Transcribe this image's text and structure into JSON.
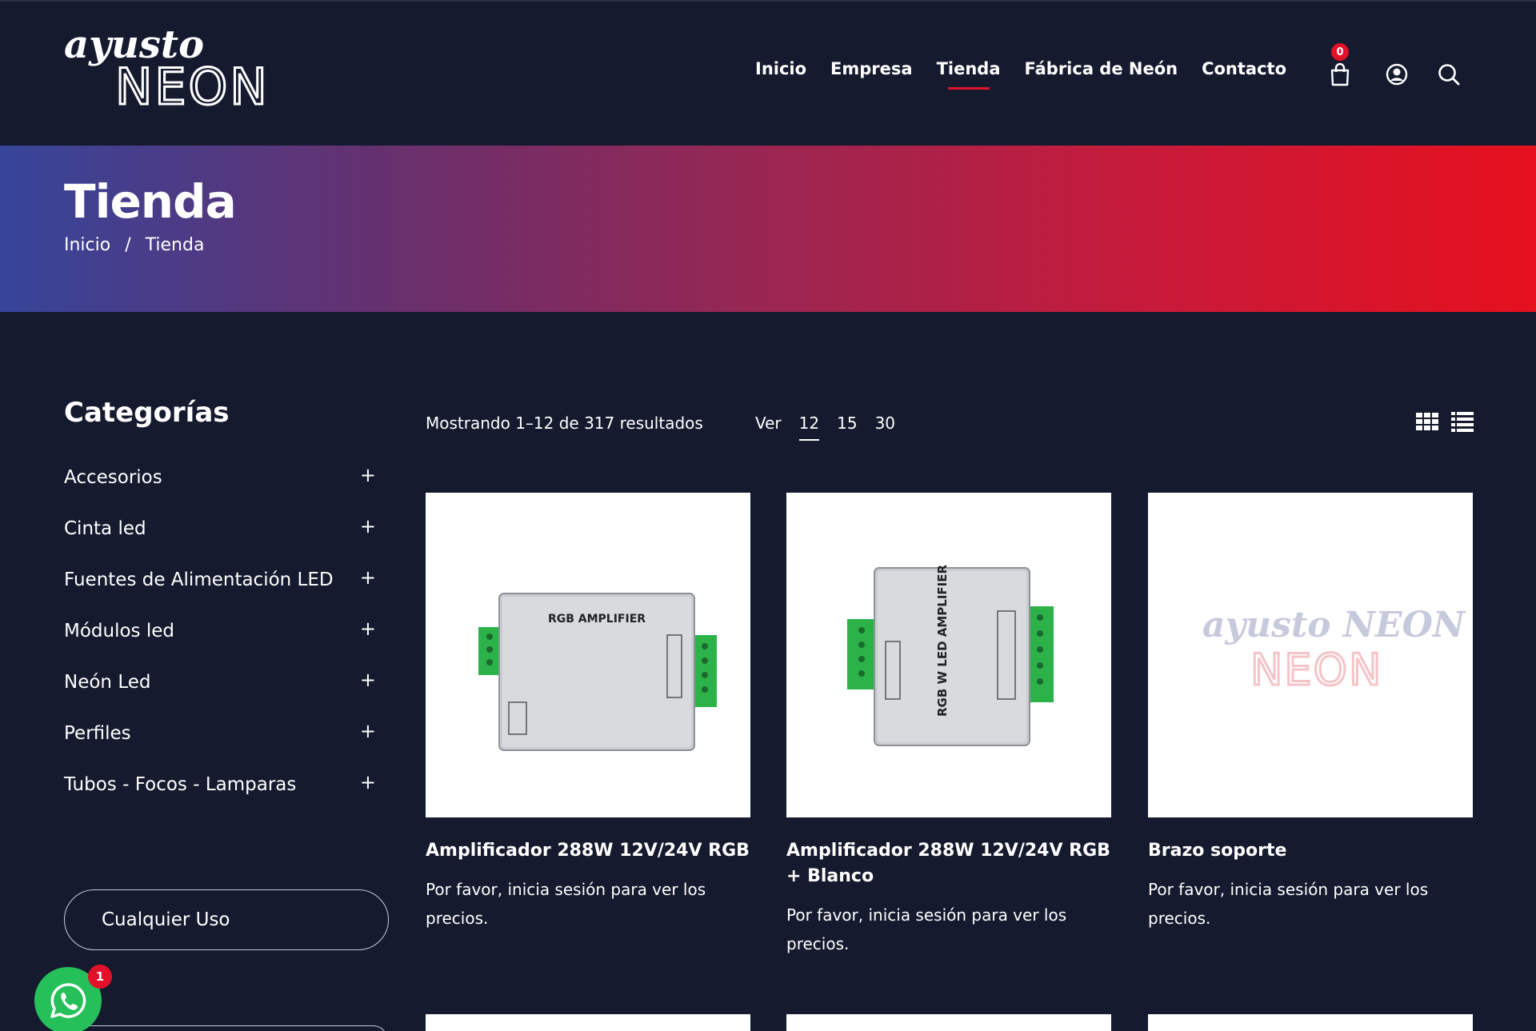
{
  "header": {
    "logo": {
      "line1": "ayusto",
      "line2": "NEON"
    },
    "nav": [
      {
        "label": "Inicio",
        "active": false
      },
      {
        "label": "Empresa",
        "active": false
      },
      {
        "label": "Tienda",
        "active": true
      },
      {
        "label": "Fábrica de Neón",
        "active": false
      },
      {
        "label": "Contacto",
        "active": false
      }
    ],
    "cart_count": "0",
    "icons": [
      "shopping-bag-icon",
      "user-icon",
      "search-icon"
    ]
  },
  "banner": {
    "title": "Tienda",
    "breadcrumb": [
      "Inicio",
      "/",
      "Tienda"
    ]
  },
  "sidebar": {
    "title": "Categorías",
    "categories": [
      {
        "label": "Accesorios",
        "expand": "+"
      },
      {
        "label": "Cinta led",
        "expand": "+"
      },
      {
        "label": "Fuentes de Alimentación LED",
        "expand": "+"
      },
      {
        "label": "Módulos led",
        "expand": "+"
      },
      {
        "label": "Neón Led",
        "expand": "+"
      },
      {
        "label": "Perfiles",
        "expand": "+"
      },
      {
        "label": "Tubos - Focos - Lamparas",
        "expand": "+"
      }
    ],
    "filter_label": "Cualquier Uso"
  },
  "toolbar": {
    "result_count": "Mostrando 1–12 de 317 resultados",
    "per_page_label": "Ver",
    "per_page_options": [
      "12",
      "15",
      "30"
    ],
    "per_page_selected": "12"
  },
  "products": [
    {
      "name": "Amplificador 288W 12V/24V RGB",
      "price_note": "Por favor, inicia sesión para ver los precios.",
      "image_text": "RGB AMPLIFIER"
    },
    {
      "name": "Amplificador 288W 12V/24V RGB + Blanco",
      "price_note": "Por favor, inicia sesión para ver los precios.",
      "image_text": "RGB W LED AMPLIFIER"
    },
    {
      "name": "Brazo soporte",
      "price_note": "Por favor, inicia sesión para ver los precios.",
      "image_text": "ayusto NEON"
    }
  ],
  "whatsapp": {
    "badge": "1"
  },
  "colors": {
    "background": "#151a2e",
    "accent": "#e3102a",
    "banner_start": "#36459a",
    "banner_end": "#e6101e",
    "whatsapp": "#25c05a"
  }
}
